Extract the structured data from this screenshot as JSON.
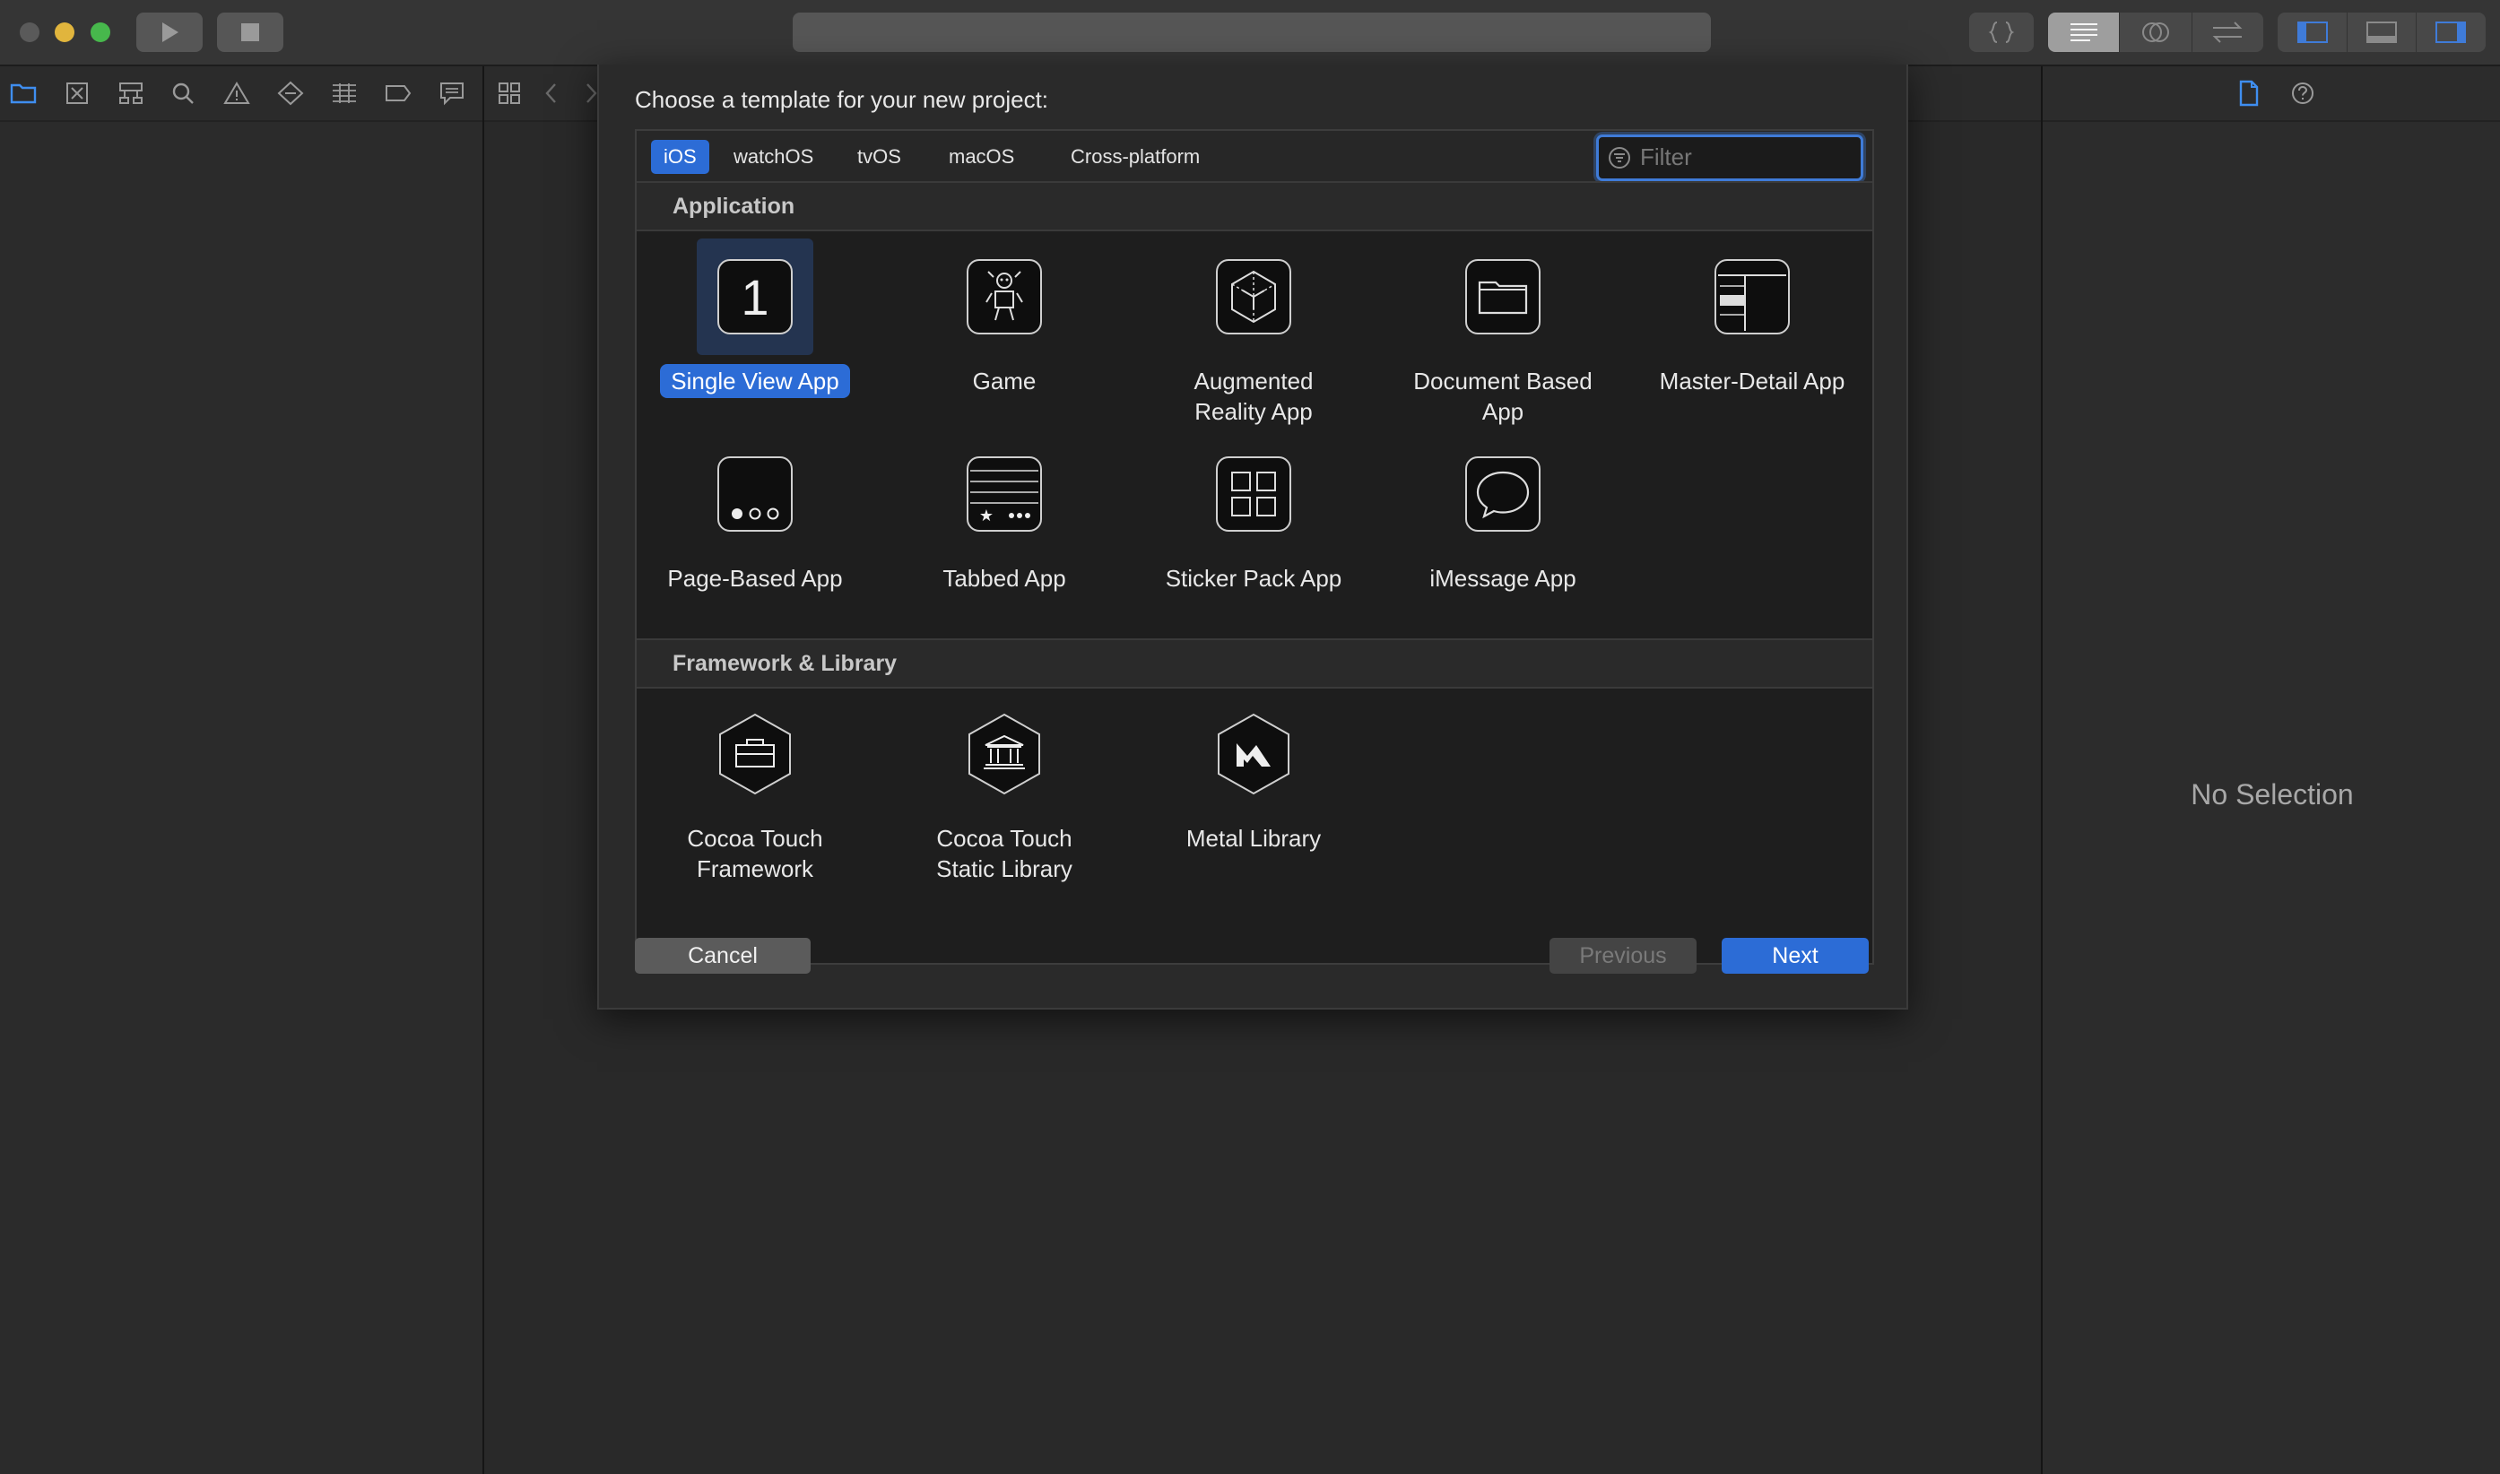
{
  "window": {
    "toolbar": {
      "activity_text": "",
      "code_review_icon": "braces-icon",
      "editor_modes": [
        "standard-editor-icon",
        "assistant-editor-icon",
        "version-editor-icon"
      ],
      "panel_toggles": [
        "navigator-toggle-icon",
        "debug-area-toggle-icon",
        "inspector-toggle-icon"
      ]
    },
    "navigator_icons": [
      "folder-icon",
      "source-control-icon",
      "hierarchy-icon",
      "search-icon",
      "warning-icon",
      "test-icon",
      "debug-icon",
      "breakpoint-icon",
      "report-icon"
    ],
    "inspector": {
      "no_selection": "No Selection"
    }
  },
  "sheet": {
    "title": "Choose a template for your new project:",
    "tabs": [
      {
        "label": "iOS",
        "selected": true
      },
      {
        "label": "watchOS",
        "selected": false
      },
      {
        "label": "tvOS",
        "selected": false
      },
      {
        "label": "macOS",
        "selected": false
      },
      {
        "label": "Cross-platform",
        "selected": false
      }
    ],
    "filter": {
      "placeholder": "Filter",
      "value": ""
    },
    "sections": [
      {
        "title": "Application",
        "templates": [
          {
            "label": "Single View App",
            "icon": "single-view-app-icon",
            "selected": true
          },
          {
            "label": "Game",
            "icon": "game-icon"
          },
          {
            "label": "Augmented Reality App",
            "icon": "augmented-reality-icon"
          },
          {
            "label": "Document Based App",
            "icon": "document-based-icon"
          },
          {
            "label": "Master-Detail App",
            "icon": "master-detail-icon"
          },
          {
            "label": "Page-Based App",
            "icon": "page-based-icon"
          },
          {
            "label": "Tabbed App",
            "icon": "tabbed-app-icon"
          },
          {
            "label": "Sticker Pack App",
            "icon": "sticker-pack-icon"
          },
          {
            "label": "iMessage App",
            "icon": "imessage-icon"
          }
        ]
      },
      {
        "title": "Framework & Library",
        "templates": [
          {
            "label": "Cocoa Touch Framework",
            "icon": "framework-icon"
          },
          {
            "label": "Cocoa Touch Static Library",
            "icon": "static-library-icon"
          },
          {
            "label": "Metal Library",
            "icon": "metal-library-icon"
          }
        ]
      }
    ],
    "buttons": {
      "cancel": "Cancel",
      "previous": "Previous",
      "next": "Next"
    }
  },
  "colors": {
    "accent": "#2c6cd6",
    "background": "#282828",
    "sheet": "#2a2a2a"
  }
}
